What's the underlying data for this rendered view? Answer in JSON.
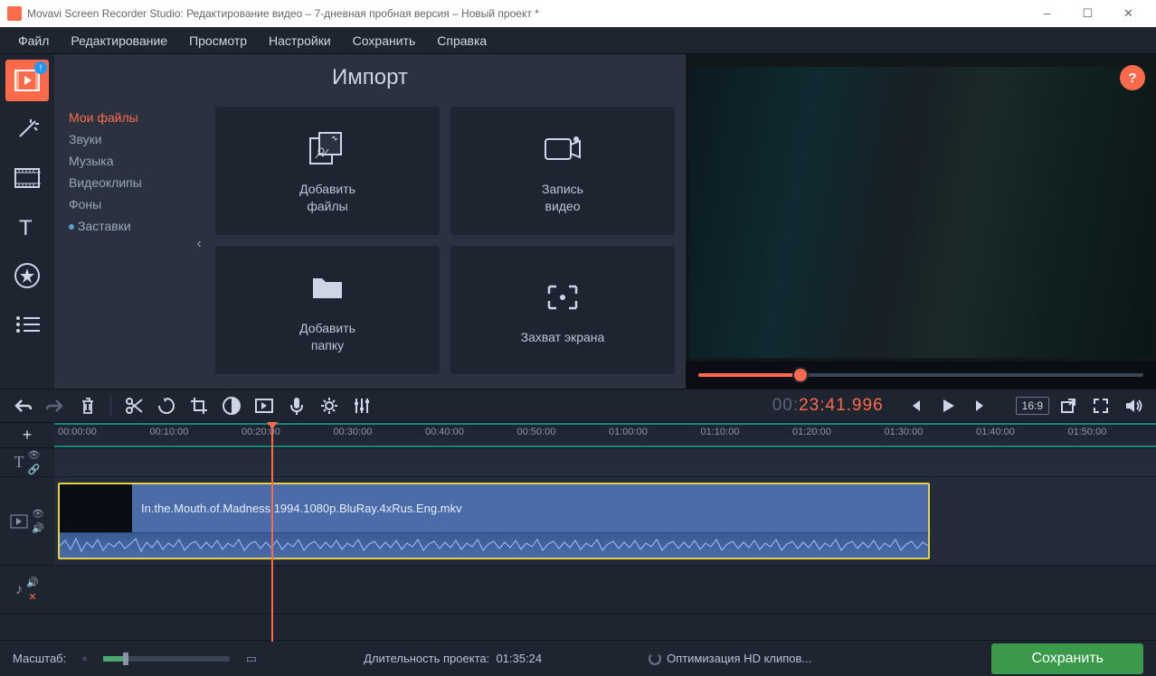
{
  "window": {
    "title": "Movavi Screen Recorder Studio: Редактирование видео – 7-дневная пробная версия – Новый проект *"
  },
  "menu": {
    "items": [
      "Файл",
      "Редактирование",
      "Просмотр",
      "Настройки",
      "Сохранить",
      "Справка"
    ]
  },
  "import": {
    "title": "Импорт",
    "categories": [
      {
        "label": "Мои файлы",
        "selected": true
      },
      {
        "label": "Звуки"
      },
      {
        "label": "Музыка"
      },
      {
        "label": "Видеоклипы"
      },
      {
        "label": "Фоны"
      },
      {
        "label": "Заставки",
        "dot": true
      }
    ],
    "cards": {
      "add_files": "Добавить\nфайлы",
      "record_video": "Запись\nвидео",
      "add_folder": "Добавить\nпапку",
      "screen_capture": "Захват экрана"
    }
  },
  "preview": {
    "help": "?",
    "aspect": "16:9"
  },
  "timecode": {
    "left": "00:",
    "right": "23:41.996"
  },
  "ruler": {
    "ticks": [
      "00:00:00",
      "00:10:00",
      "00:20:00",
      "00:30:00",
      "00:40:00",
      "00:50:00",
      "01:00:00",
      "01:10:00",
      "01:20:00",
      "01:30:00",
      "01:40:00",
      "01:50:00"
    ]
  },
  "timeline": {
    "clip_name": "In.the.Mouth.of.Madness.1994.1080p.BluRay.4xRus.Eng.mkv"
  },
  "status": {
    "zoom_label": "Масштаб:",
    "duration_label": "Длительность проекта:",
    "duration_value": "01:35:24",
    "optimizing": "Оптимизация HD клипов...",
    "save": "Сохранить"
  }
}
